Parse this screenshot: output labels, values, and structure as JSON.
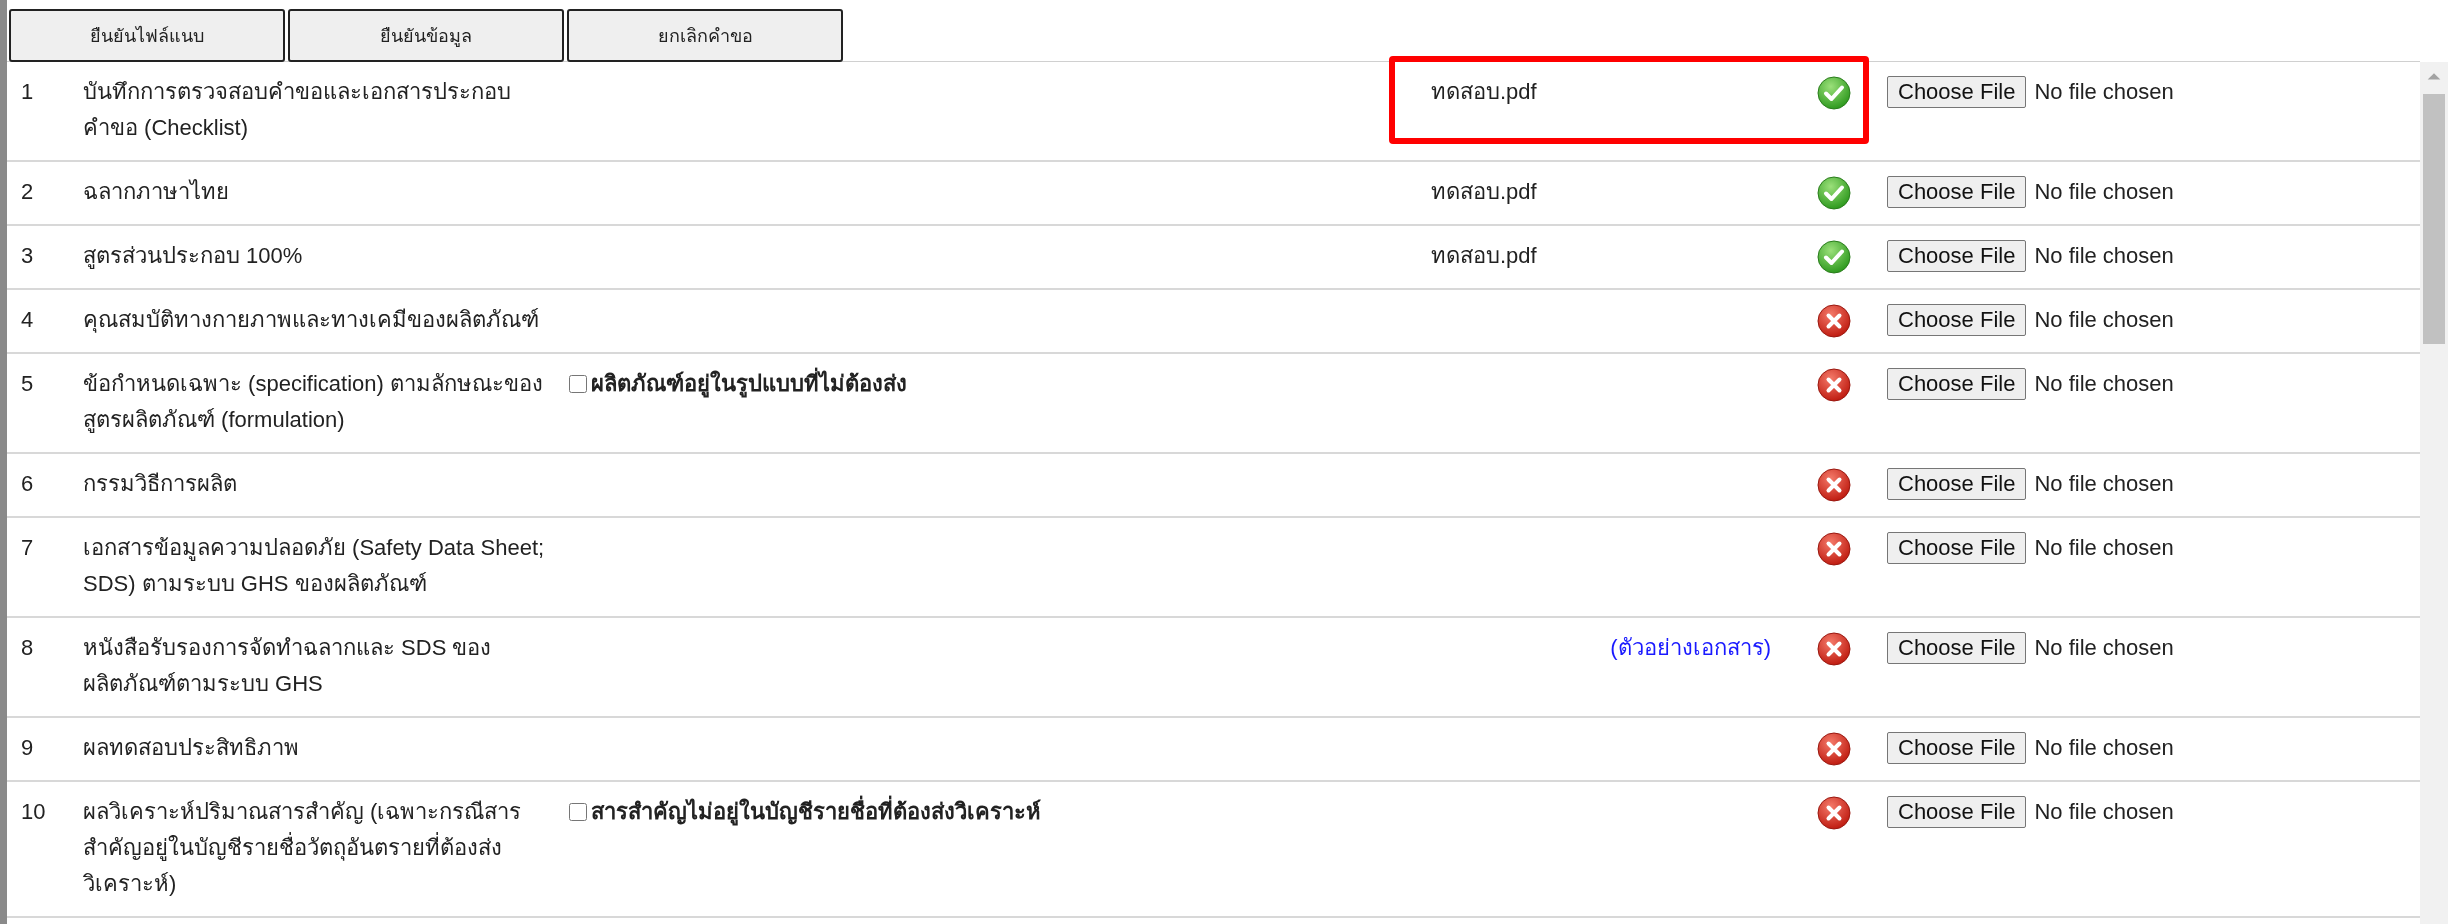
{
  "buttons": [
    "ยืนยันไฟล์แนบ",
    "ยืนยันข้อมูล",
    "ยกเลิกคำขอ"
  ],
  "rows": [
    {
      "number": "1",
      "title": "บันทึกการตรวจสอบคำขอและเอกสารประกอบคำขอ (Checklist)",
      "file": "ทดสอบ.pdf",
      "uploaded": true,
      "highlighted": true,
      "file_button": "Choose File",
      "file_value": "No file chosen"
    },
    {
      "number": "2",
      "title": "ฉลากภาษาไทย",
      "file": "ทดสอบ.pdf",
      "uploaded": true,
      "highlighted": false,
      "file_button": "Choose File",
      "file_value": "No file chosen"
    },
    {
      "number": "3",
      "title": "สูตรส่วนประกอบ 100%",
      "file": "ทดสอบ.pdf",
      "uploaded": true,
      "highlighted": false,
      "file_button": "Choose File",
      "file_value": "No file chosen"
    },
    {
      "number": "4",
      "title": "คุณสมบัติทางกายภาพและทางเคมีของผลิตภัณฑ์",
      "uploaded": false,
      "highlighted": false,
      "file_button": "Choose File",
      "file_value": "No file chosen"
    },
    {
      "number": "5",
      "title": "ข้อกำหนดเฉพาะ (specification) ตามลักษณะของสูตรผลิตภัณฑ์ (formulation)",
      "option": {
        "label": "ผลิตภัณฑ์อยู่ในรูปแบบที่ไม่ต้องส่ง",
        "checked": false
      },
      "uploaded": false,
      "highlighted": false,
      "file_button": "Choose File",
      "file_value": "No file chosen"
    },
    {
      "number": "6",
      "title": "กรรมวิธีการผลิต",
      "uploaded": false,
      "highlighted": false,
      "file_button": "Choose File",
      "file_value": "No file chosen"
    },
    {
      "number": "7",
      "title": "เอกสารข้อมูลความปลอดภัย (Safety Data Sheet; SDS) ตามระบบ GHS ของผลิตภัณฑ์",
      "uploaded": false,
      "highlighted": false,
      "file_button": "Choose File",
      "file_value": "No file chosen"
    },
    {
      "number": "8",
      "title": "หนังสือรับรองการจัดทำฉลากและ SDS ของผลิตภัณฑ์ตามระบบ GHS",
      "link": "(ตัวอย่างเอกสาร)",
      "uploaded": false,
      "highlighted": false,
      "file_button": "Choose File",
      "file_value": "No file chosen"
    },
    {
      "number": "9",
      "title": "ผลทดสอบประสิทธิภาพ",
      "uploaded": false,
      "highlighted": false,
      "file_button": "Choose File",
      "file_value": "No file chosen"
    },
    {
      "number": "10",
      "title": "ผลวิเคราะห์ปริมาณสารสำคัญ (เฉพาะกรณีสารสำคัญอยู่ในบัญชีรายชื่อวัตถุอันตรายที่ต้องส่งวิเคราะห์)",
      "option": {
        "label": "สารสำคัญไม่อยู่ในบัญชีรายชื่อที่ต้องส่งวิเคราะห์",
        "checked": false
      },
      "uploaded": false,
      "highlighted": false,
      "file_button": "Choose File",
      "file_value": "No file chosen"
    }
  ]
}
